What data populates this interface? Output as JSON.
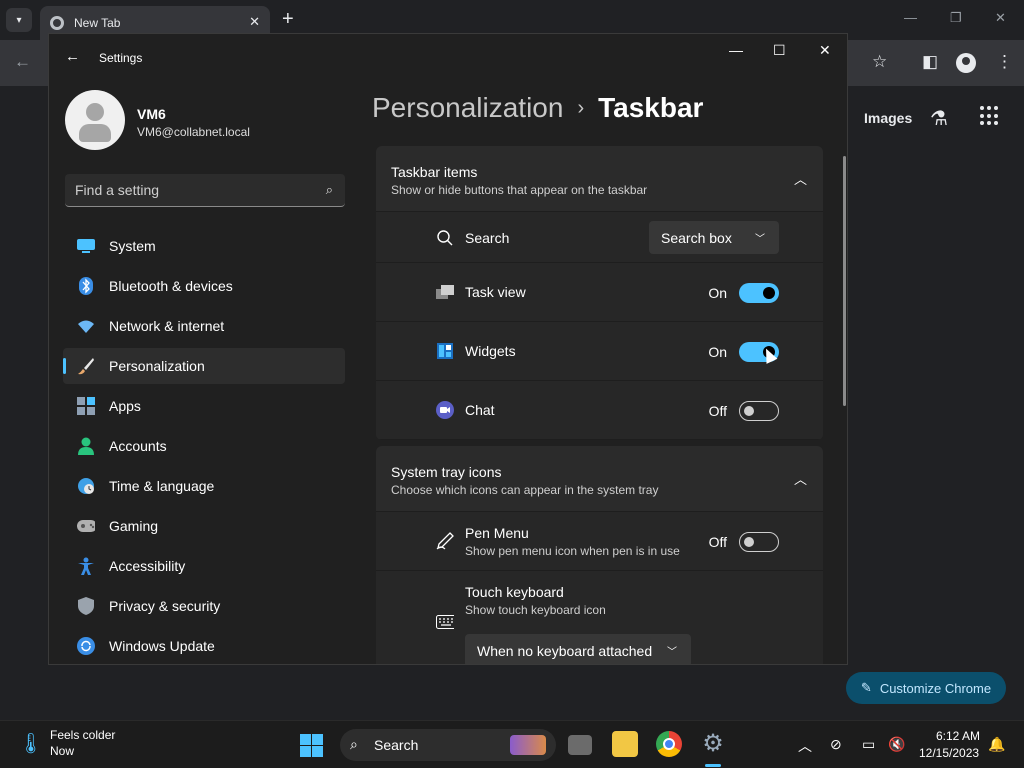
{
  "chrome": {
    "tab_title": "New Tab",
    "ntp_images_link": "Images",
    "customize_label": "Customize Chrome"
  },
  "settings": {
    "window_title": "Settings",
    "user": {
      "name": "VM6",
      "email": "VM6@collabnet.local"
    },
    "search": {
      "placeholder": "Find a setting"
    },
    "nav": [
      {
        "label": "System",
        "icon": "monitor-icon",
        "color": "#4cc2ff"
      },
      {
        "label": "Bluetooth & devices",
        "icon": "bluetooth-icon",
        "color": "#3a8ee6"
      },
      {
        "label": "Network & internet",
        "icon": "wifi-icon",
        "color": "#6cb8f6"
      },
      {
        "label": "Personalization",
        "icon": "brush-icon",
        "color": "#e8a86b",
        "selected": true
      },
      {
        "label": "Apps",
        "icon": "apps-icon",
        "color": "#8e9fb3"
      },
      {
        "label": "Accounts",
        "icon": "person-icon",
        "color": "#29c47e"
      },
      {
        "label": "Time & language",
        "icon": "globe-clock-icon",
        "color": "#3fa0e6"
      },
      {
        "label": "Gaming",
        "icon": "gamepad-icon",
        "color": "#b0b0b0"
      },
      {
        "label": "Accessibility",
        "icon": "accessibility-icon",
        "color": "#3a8ee6"
      },
      {
        "label": "Privacy & security",
        "icon": "shield-icon",
        "color": "#9aa3ad"
      },
      {
        "label": "Windows Update",
        "icon": "update-icon",
        "color": "#3a8ee6"
      }
    ],
    "breadcrumb": {
      "parent": "Personalization",
      "current": "Taskbar"
    },
    "groups": {
      "taskbar_items": {
        "title": "Taskbar items",
        "subtitle": "Show or hide buttons that appear on the taskbar",
        "rows": {
          "search": {
            "label": "Search",
            "value": "Search box"
          },
          "task_view": {
            "label": "Task view",
            "state": "On",
            "on": true
          },
          "widgets": {
            "label": "Widgets",
            "state": "On",
            "on": true
          },
          "chat": {
            "label": "Chat",
            "state": "Off",
            "on": false
          }
        }
      },
      "system_tray": {
        "title": "System tray icons",
        "subtitle": "Choose which icons can appear in the system tray",
        "rows": {
          "pen_menu": {
            "label": "Pen Menu",
            "sub": "Show pen menu icon when pen is in use",
            "state": "Off",
            "on": false
          },
          "touch_keyboard": {
            "label": "Touch keyboard",
            "sub": "Show touch keyboard icon",
            "value": "When no keyboard attached"
          }
        }
      }
    },
    "accent_color": "#4cc2ff"
  },
  "taskbar": {
    "weather": {
      "title": "Feels colder",
      "sub": "Now"
    },
    "search_label": "Search",
    "clock": {
      "time": "6:12 AM",
      "date": "12/15/2023"
    }
  }
}
